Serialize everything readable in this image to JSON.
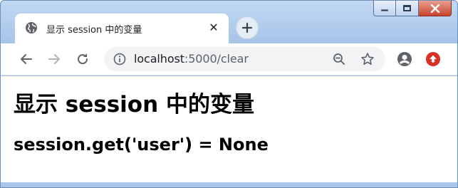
{
  "browser": {
    "tab": {
      "title": "显示 session 中的变量",
      "close_glyph": "✕",
      "icon": "globe-icon"
    },
    "new_tab": {
      "glyph": "+"
    },
    "address_bar": {
      "host": "localhost",
      "path": ":5000/clear"
    },
    "window_controls": [
      "minimize",
      "maximize",
      "close"
    ],
    "colors": {
      "frame": "#a9c7ea",
      "close_button": "#c8452f",
      "update_badge": "#d93025"
    }
  },
  "page": {
    "heading": "显示 session 中的变量",
    "subheading": "session.get('user') = None"
  }
}
